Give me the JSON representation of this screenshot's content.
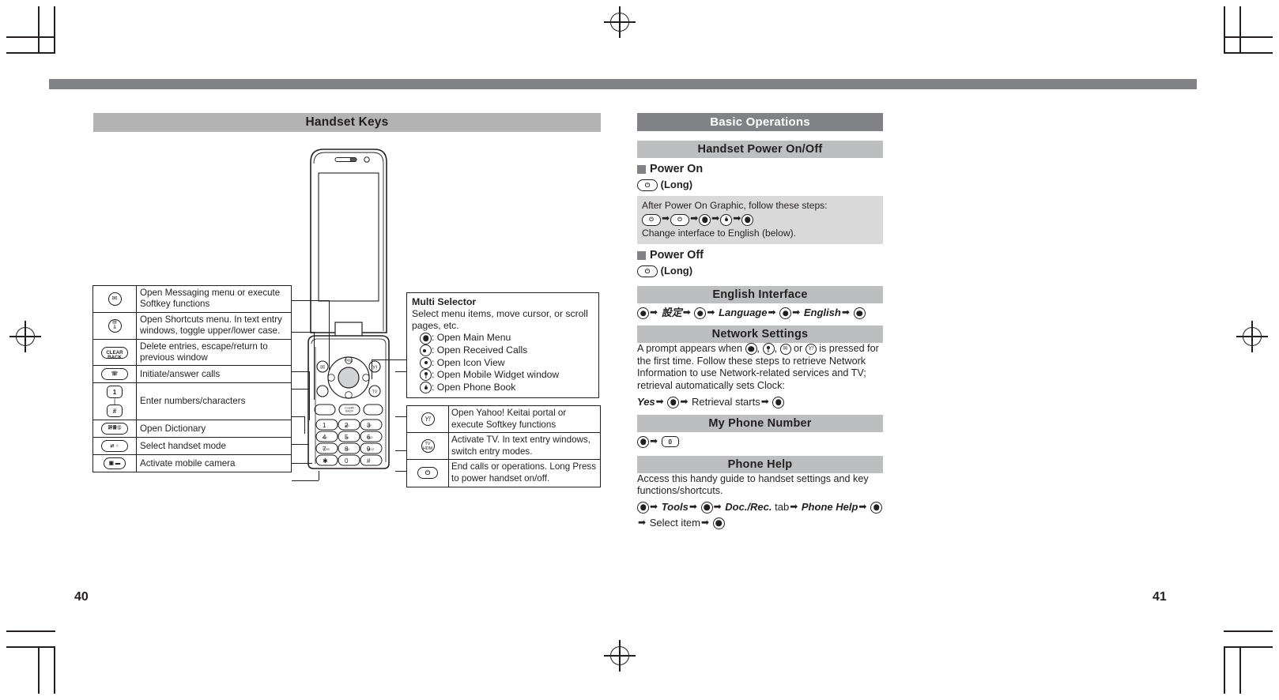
{
  "document": {
    "left_page_number": "40",
    "right_page_number": "41"
  },
  "left_page": {
    "title": "Handset Keys",
    "key_table_left": [
      {
        "key_icon": "envelope-key-icon",
        "key_label": "",
        "description": "Open Messaging menu or execute Softkey functions"
      },
      {
        "key_icon": "shortcuts-key-icon",
        "key_label": "",
        "description": "Open Shortcuts menu. In text entry windows, toggle upper/lower case."
      },
      {
        "key_icon": "clear-back-key-icon",
        "key_label": "CLEAR BACK",
        "description": "Delete entries, escape/return to previous window"
      },
      {
        "key_icon": "call-key-icon",
        "key_label": "",
        "description": "Initiate/answer calls"
      },
      {
        "key_icon": "number-keys-icon",
        "key_label": "1 … #",
        "description": "Enter numbers/characters"
      },
      {
        "key_icon": "dictionary-key-icon",
        "key_label": "",
        "description": "Open Dictionary"
      },
      {
        "key_icon": "mode-key-icon",
        "key_label": "",
        "description": "Select handset mode"
      },
      {
        "key_icon": "camera-key-icon",
        "key_label": "",
        "description": "Activate mobile camera"
      }
    ],
    "multi_selector": {
      "title": "Multi Selector",
      "description": "Select menu items, move cursor, or scroll pages, etc.",
      "items": [
        {
          "glyph": "center-select-icon",
          "text": ": Open Main Menu"
        },
        {
          "glyph": "left-select-icon",
          "text": ": Open Received Calls"
        },
        {
          "glyph": "right-select-icon",
          "text": ": Open Icon View"
        },
        {
          "glyph": "up-select-icon",
          "text": ": Open Mobile Widget window"
        },
        {
          "glyph": "down-select-icon",
          "text": ": Open Phone Book"
        }
      ]
    },
    "key_table_right": [
      {
        "key_icon": "yahoo-keitai-key-icon",
        "description": "Open Yahoo! Keitai portal or execute Softkey functions"
      },
      {
        "key_icon": "tv-key-icon",
        "description": "Activate TV. In text entry windows, switch entry modes."
      },
      {
        "key_icon": "power-end-key-icon",
        "description": "End calls or operations. Long Press to power handset on/off."
      }
    ]
  },
  "right_page": {
    "section_title": "Basic Operations",
    "handset_power": {
      "heading": "Handset Power On/Off",
      "power_on_label": "Power On",
      "power_on_step_suffix": "(Long)",
      "note_line1": "After Power On Graphic, follow these steps:",
      "note_line2": "Change interface to English (below).",
      "power_off_label": "Power Off",
      "power_off_step_suffix": "(Long)"
    },
    "english_interface": {
      "heading": "English Interface",
      "step_settings": "設定",
      "step_language": "Language",
      "step_english": "English"
    },
    "network_settings": {
      "heading": "Network Settings",
      "body_1": "A prompt appears when ",
      "body_2": ", ",
      "body_3": ", ",
      "body_4": " or ",
      "body_5": " is pressed for the first time. Follow these steps to retrieve Network Information to use Network-related services and TV; retrieval automatically sets Clock:",
      "step_yes": "Yes",
      "step_retrieval": "Retrieval starts"
    },
    "my_phone_number": {
      "heading": "My Phone Number"
    },
    "phone_help": {
      "heading": "Phone Help",
      "body": "Access this handy guide to handset settings and key functions/shortcuts.",
      "step_tools": "Tools",
      "step_docrec": "Doc./Rec.",
      "step_tab": "tab",
      "step_phonehelp": "Phone Help",
      "step_select": "Select item"
    }
  }
}
